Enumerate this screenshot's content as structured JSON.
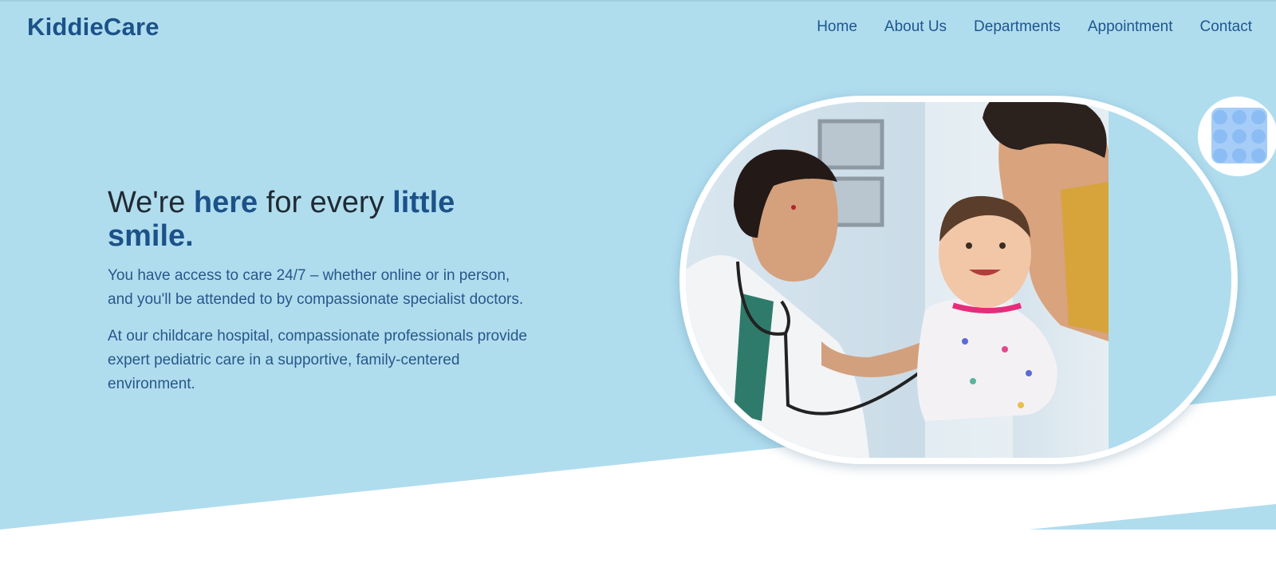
{
  "brand": {
    "name": "KiddieCare"
  },
  "nav": {
    "items": [
      {
        "label": "Home"
      },
      {
        "label": "About Us"
      },
      {
        "label": "Departments"
      },
      {
        "label": "Appointment"
      },
      {
        "label": "Contact"
      }
    ]
  },
  "hero": {
    "headline": {
      "part1": "We're ",
      "highlight1": "here",
      "part2": " for every ",
      "highlight2": "little smile."
    },
    "paragraph1": "You have access to care 24/7 – whether online or in person, and you'll be attended to by compassionate specialist doctors.",
    "paragraph2": "At our childcare hospital, compassionate professionals provide expert pediatric care in a supportive, family-centered environment.",
    "image_icon": "doctor-with-child-photo",
    "badge_icon": "dots-pattern-icon"
  },
  "colors": {
    "hero_bg": "#b0ddee",
    "brand_blue": "#1c5289",
    "text_blue": "#27578a",
    "headline_dark": "#1f2a33",
    "white": "#ffffff"
  }
}
